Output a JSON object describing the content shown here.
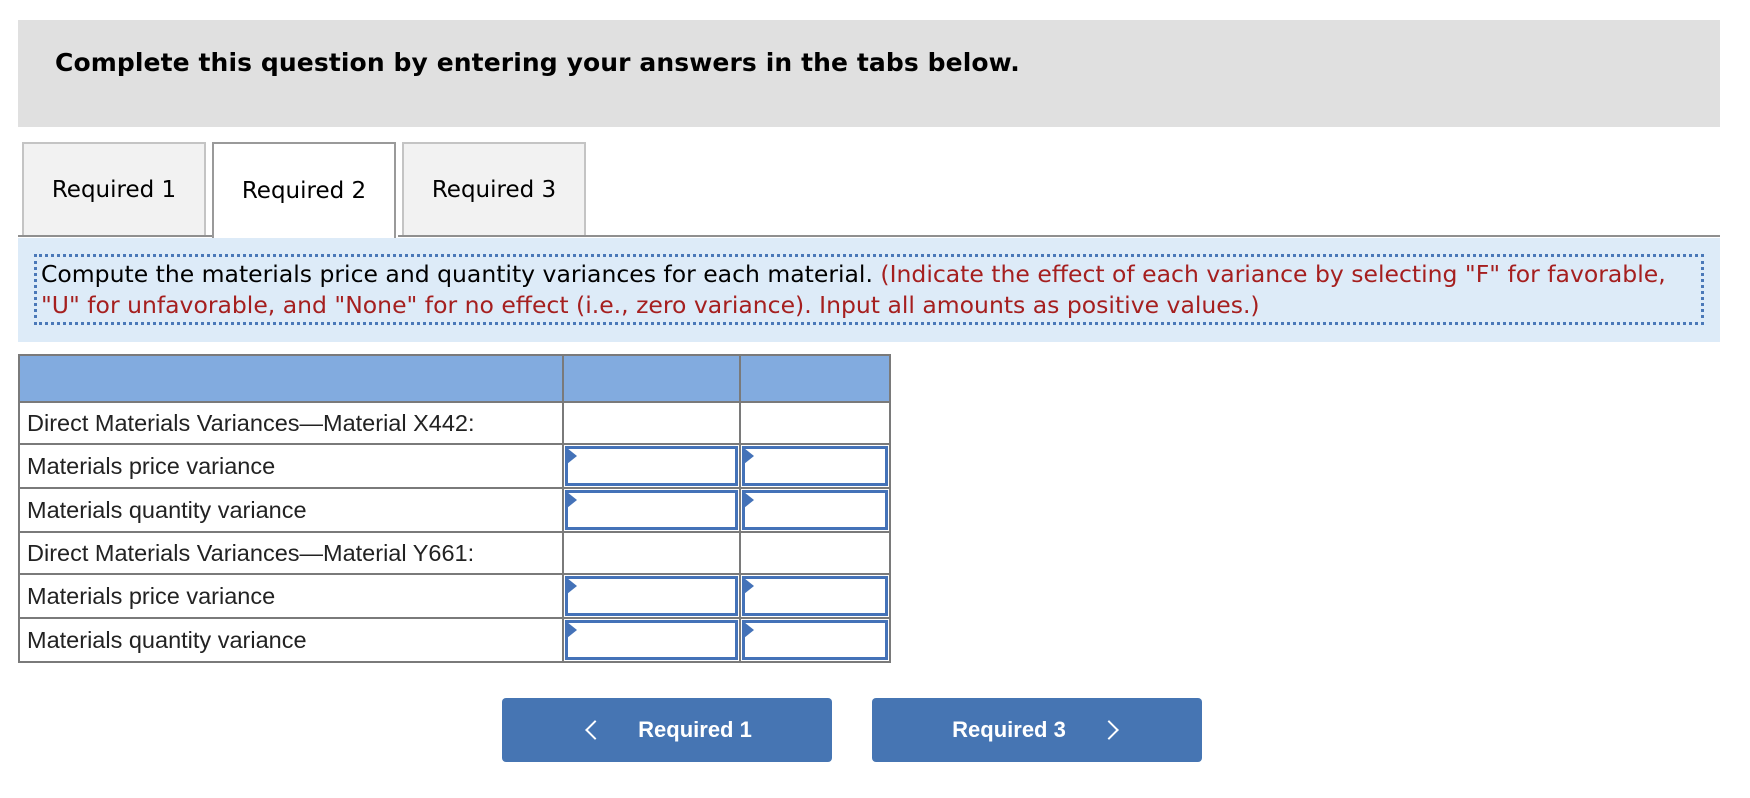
{
  "header": {
    "title": "Complete this question by entering your answers in the tabs below."
  },
  "tabs": [
    {
      "label": "Required 1",
      "active": false
    },
    {
      "label": "Required 2",
      "active": true
    },
    {
      "label": "Required 3",
      "active": false
    }
  ],
  "instructions": {
    "main": "Compute the materials price and quantity variances for each material.",
    "note": "(Indicate the effect of each variance by selecting \"F\" for favorable, \"U\" for unfavorable, and \"None\" for no effect (i.e., zero variance). Input all amounts as positive values.)"
  },
  "table": {
    "header": [
      "",
      "",
      ""
    ],
    "rows": [
      {
        "label": "Direct Materials Variances—Material X442:",
        "type": "section",
        "amount": "",
        "effect": ""
      },
      {
        "label": "Materials price variance",
        "type": "input",
        "amount": "",
        "effect": ""
      },
      {
        "label": "Materials quantity variance",
        "type": "input",
        "amount": "",
        "effect": ""
      },
      {
        "label": "Direct Materials Variances—Material Y661:",
        "type": "section",
        "amount": "",
        "effect": ""
      },
      {
        "label": "Materials price variance",
        "type": "input",
        "amount": "",
        "effect": ""
      },
      {
        "label": "Materials quantity variance",
        "type": "input",
        "amount": "",
        "effect": ""
      }
    ]
  },
  "navigation": {
    "prev_label": "Required 1",
    "next_label": "Required 3",
    "prev_icon": "chevron-left-icon",
    "next_icon": "chevron-right-icon"
  },
  "colors": {
    "header_bg": "#e0e0e0",
    "panel_bg": "#ddebf8",
    "table_header_bg": "#82abdf",
    "input_border": "#4472b8",
    "button_bg": "#4675b3",
    "note_text": "#a51f1f"
  }
}
